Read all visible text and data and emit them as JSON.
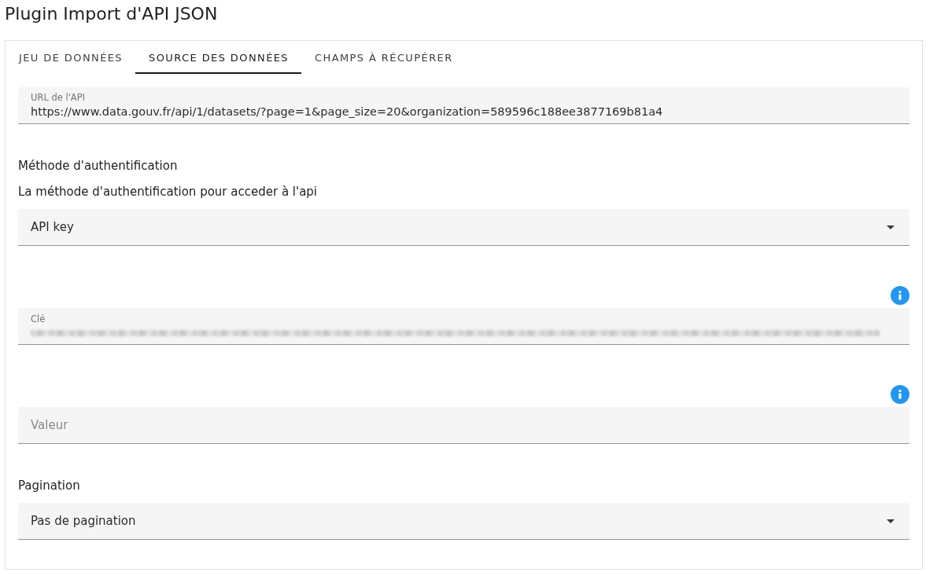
{
  "page_title": "Plugin Import d'API JSON",
  "tabs": [
    {
      "label": "JEU DE DONNÉES",
      "selected": false
    },
    {
      "label": "SOURCE DES DONNÉES",
      "selected": true
    },
    {
      "label": "CHAMPS À RÉCUPÉRER",
      "selected": false
    }
  ],
  "form": {
    "items": [
      {
        "kind": "text_field",
        "label": "URL de l'API",
        "value": "https://www.data.gouv.fr/api/1/datasets/?page=1&page_size=20&organization=589596c188ee3877169b81a4"
      },
      {
        "kind": "heading",
        "text": "Méthode d'authentification"
      },
      {
        "kind": "hint",
        "text": "La méthode d'authentification pour acceder à l'api"
      },
      {
        "kind": "select",
        "value": "API key"
      },
      {
        "kind": "text_field",
        "label": "Clé",
        "info": true,
        "blurred": true
      },
      {
        "kind": "text_field",
        "placeholder": "Valeur",
        "info": true
      },
      {
        "kind": "heading",
        "text": "Pagination"
      },
      {
        "kind": "select",
        "value": "Pas de pagination"
      }
    ]
  }
}
